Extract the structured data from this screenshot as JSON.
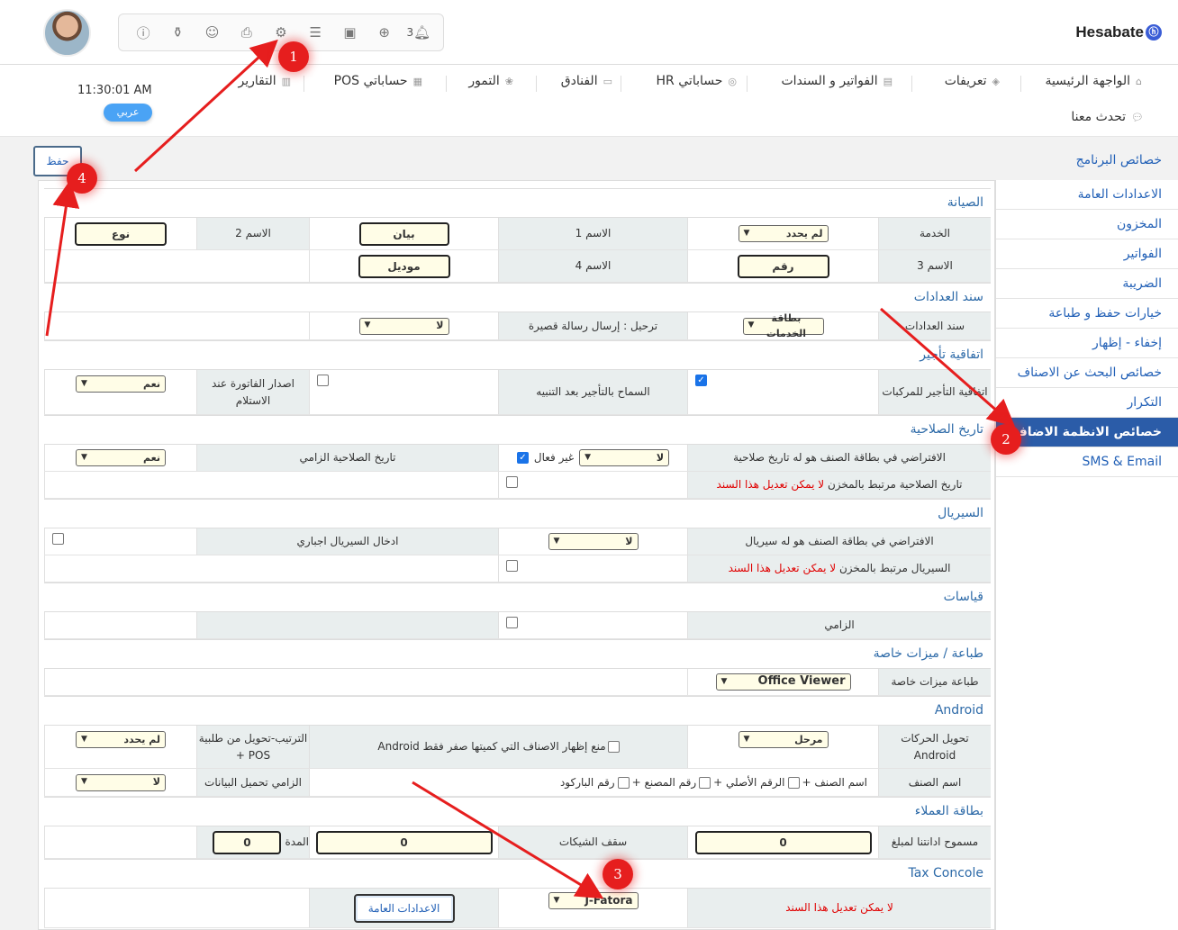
{
  "brand": {
    "name": "Hesabate",
    "logo_mark": "ⓗ"
  },
  "toolbar": {
    "notification_count": "3"
  },
  "nav": {
    "items": [
      {
        "label": "الواجهة الرئيسية",
        "icon": "home-icon"
      },
      {
        "label": "تعريفات",
        "icon": "layers-icon"
      },
      {
        "label": "الفواتير و السندات",
        "icon": "invoice-icon"
      },
      {
        "label": "حساباتي HR",
        "icon": "target-icon"
      },
      {
        "label": "الفنادق",
        "icon": "hotel-icon"
      },
      {
        "label": "التمور",
        "icon": "dates-icon"
      },
      {
        "label": "حساباتي POS",
        "icon": "pos-icon"
      },
      {
        "label": "التقارير",
        "icon": "reports-icon"
      }
    ],
    "chat": "تحدث معنا"
  },
  "clock": "11:30:01 AM",
  "language": "عربي",
  "page": {
    "title": "خصائص البرنامج",
    "save": "حفظ"
  },
  "sidebar": [
    "الاعدادات العامة",
    "المخزون",
    "الفواتير",
    "الضريبة",
    "خيارات حفظ و طباعة",
    "إخفاء - إظهار",
    "خصائص البحث عن الاصناف",
    "التكرار",
    "خصائص الانظمة الاضافية",
    "SMS & Email"
  ],
  "maintenance": {
    "title": "الصيانة",
    "service_label": "الخدمة",
    "service_value": "لم يحدد",
    "name1_label": "الاسم 1",
    "name1_value": "بيان",
    "name2_label": "الاسم 2",
    "name2_value": "نوع",
    "name3_label": "الاسم 3",
    "name3_value": "رقم",
    "name4_label": "الاسم 4",
    "name4_value": "موديل"
  },
  "meter": {
    "title": "سند العدادات",
    "label": "سند العدادات",
    "value": "بطاقة الخدمات",
    "sms_label": "ترحيل : إرسال رسالة قصيرة",
    "sms_value": "لا"
  },
  "rental": {
    "title": "اتفاقية تأجير",
    "vehicles_label": "اتفاقية التأجير للمركبات",
    "allow_label": "السماح بالتأجير بعد التنبيه",
    "invoice_label": "اصدار الفاتورة عند الاستلام",
    "invoice_value": "نعم"
  },
  "expiry": {
    "title": "تاريخ الصلاحية",
    "default_label": "الافتراضي في بطاقة الصنف هو له تاريخ صلاحية",
    "default_value": "لا",
    "inactive_label": "غير فعال",
    "mandatory_label": "تاريخ الصلاحية الزامي",
    "mandatory_value": "نعم",
    "linked_label": "تاريخ الصلاحية مرتبط بالمخزن",
    "linked_warning": "لا يمكن تعديل هذا السند"
  },
  "serial": {
    "title": "السيريال",
    "default_label": "الافتراضي في بطاقة الصنف هو له سيريال",
    "default_value": "لا",
    "mandatory_label": "ادخال السيريال اجباري",
    "linked_label": "السيريال مرتبط بالمخزن",
    "linked_warning": "لا يمكن تعديل هذا السند"
  },
  "measures": {
    "title": "قياسات",
    "mandatory_label": "الزامي"
  },
  "printing": {
    "title": "طباعة / ميزات خاصة",
    "label": "طباعة ميزات خاصة",
    "value": "Office Viewer"
  },
  "android": {
    "title": "Android",
    "transfer_label": "تحويل الحركات Android",
    "transfer_value": "مرحل",
    "hide_zero_label": "منع إظهار الاصناف التي كميتها صفر فقط Android",
    "order_label": "الترتيب-تحويل من طلبية POS +",
    "order_value": "لم يحدد",
    "item_name_label": "اسم الصنف",
    "opt_name": "اسم الصنف +",
    "opt_original": "الرقم الأصلي +",
    "opt_factory": "رقم المصنع +",
    "opt_barcode": "رقم الباركود",
    "load_label": "الزامي تحميل البيانات",
    "load_value": "لا"
  },
  "customer_card": {
    "title": "بطاقة العملاء",
    "debt_label": "مسموح ادانتنا لمبلغ",
    "debt_value": "0",
    "checks_label": "سقف الشيكات",
    "checks_value": "0",
    "period_label": "المدة",
    "period_value": "0"
  },
  "tax": {
    "title": "Tax Concole",
    "warning": "لا يمكن تعديل هذا السند",
    "value": "J-Fatora",
    "general_button": "الاعدادات العامة"
  },
  "markers": [
    "1",
    "2",
    "3",
    "4"
  ],
  "colors": {
    "accent": "#2361b7",
    "active_sidebar": "#2b5ca8",
    "marker": "#e61e1e",
    "warning": "#e00000"
  }
}
